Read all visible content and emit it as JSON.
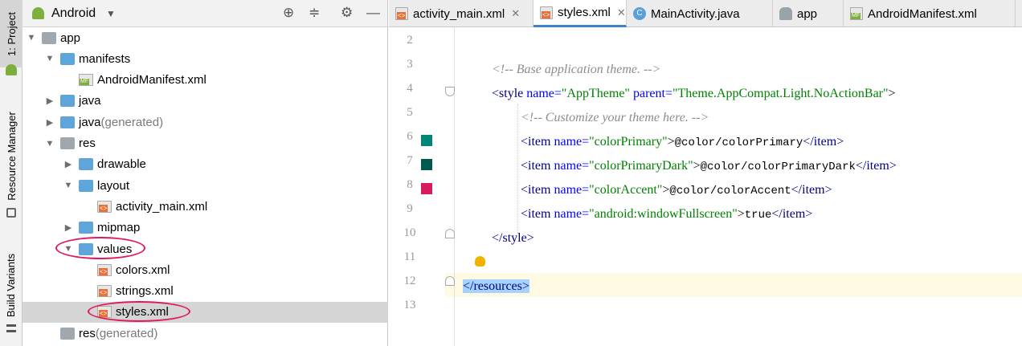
{
  "tool_strip": {
    "project": "1: Project",
    "resource_manager": "Resource Manager",
    "build_variants": "Build Variants"
  },
  "project_panel": {
    "view_selector": "Android",
    "tree": [
      {
        "label": "app",
        "depth": 0,
        "expanded": true,
        "icon": "module-folder-icon"
      },
      {
        "label": "manifests",
        "depth": 1,
        "expanded": true,
        "icon": "folder-icon"
      },
      {
        "label": "AndroidManifest.xml",
        "depth": 2,
        "icon": "manifest-file-icon"
      },
      {
        "label": "java",
        "depth": 1,
        "expanded": false,
        "icon": "folder-icon"
      },
      {
        "label": "java",
        "suffix": "(generated)",
        "depth": 1,
        "expanded": false,
        "icon": "generated-folder-icon"
      },
      {
        "label": "res",
        "depth": 1,
        "expanded": true,
        "icon": "res-folder-icon"
      },
      {
        "label": "drawable",
        "depth": 2,
        "expanded": false,
        "icon": "folder-icon"
      },
      {
        "label": "layout",
        "depth": 2,
        "expanded": true,
        "icon": "folder-icon"
      },
      {
        "label": "activity_main.xml",
        "depth": 3,
        "icon": "xml-file-icon"
      },
      {
        "label": "mipmap",
        "depth": 2,
        "expanded": false,
        "icon": "folder-icon"
      },
      {
        "label": "values",
        "depth": 2,
        "expanded": true,
        "icon": "folder-icon"
      },
      {
        "label": "colors.xml",
        "depth": 3,
        "icon": "xml-file-icon"
      },
      {
        "label": "strings.xml",
        "depth": 3,
        "icon": "xml-file-icon"
      },
      {
        "label": "styles.xml",
        "depth": 3,
        "icon": "xml-file-icon",
        "selected": true
      },
      {
        "label": "res",
        "suffix": "(generated)",
        "depth": 1,
        "icon": "res-folder-icon"
      }
    ]
  },
  "editor_tabs": [
    {
      "label": "activity_main.xml",
      "icon": "xml-file-icon"
    },
    {
      "label": "styles.xml",
      "icon": "xml-file-icon",
      "active": true
    },
    {
      "label": "MainActivity.java",
      "icon": "class-icon"
    },
    {
      "label": "app",
      "icon": "gradle-icon"
    },
    {
      "label": "AndroidManifest.xml",
      "icon": "manifest-file-icon"
    }
  ],
  "editor": {
    "line_numbers": [
      "2",
      "3",
      "4",
      "5",
      "6",
      "7",
      "8",
      "9",
      "10",
      "11",
      "12",
      "13"
    ],
    "color_swatches": {
      "colorPrimary": "#008577",
      "colorPrimaryDark": "#00574B",
      "colorAccent": "#D81B60"
    },
    "code": {
      "l3_comment": "<!-- Base application theme. -->",
      "l4_open": "<style",
      "l4_attr1": "name=",
      "l4_val1": "\"AppTheme\"",
      "l4_attr2": "parent=",
      "l4_val2": "\"Theme.AppCompat.Light.NoActionBar\"",
      "l4_close": ">",
      "l5_comment": "<!-- Customize your theme here. -->",
      "item_open": "<item",
      "item_attr": "name=",
      "item_close_tag": "</item>",
      "l6_val": "\"colorPrimary\"",
      "l6_text": "@color/colorPrimary",
      "l7_val": "\"colorPrimaryDark\"",
      "l7_text": "@color/colorPrimaryDark",
      "l8_val": "\"colorAccent\"",
      "l8_text": "@color/colorAccent",
      "l9_val": "\"android:windowFullscreen\"",
      "l9_text": "true",
      "gt": ">",
      "l10": "</style>",
      "l12": "</resources>"
    }
  }
}
